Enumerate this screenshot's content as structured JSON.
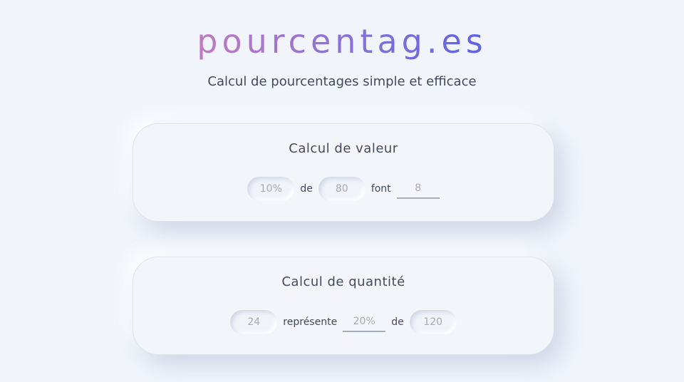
{
  "header": {
    "logo": "pourcentag.es",
    "tagline": "Calcul de pourcentages simple et efficace"
  },
  "cards": [
    {
      "title": "Calcul de valeur",
      "field_percent": "10%",
      "word_de": "de",
      "field_total": "80",
      "word_font": "font",
      "field_result": "8"
    },
    {
      "title": "Calcul de quantité",
      "field_value": "24",
      "word_represente": "représente",
      "field_percent": "20%",
      "word_de": "de",
      "field_total": "120"
    }
  ],
  "colors": {
    "background": "#f1f4fb",
    "logo_gradient_start": "#c07bc0",
    "logo_gradient_end": "#5d64e2",
    "text": "#434b5c",
    "placeholder": "#a6aab6"
  }
}
